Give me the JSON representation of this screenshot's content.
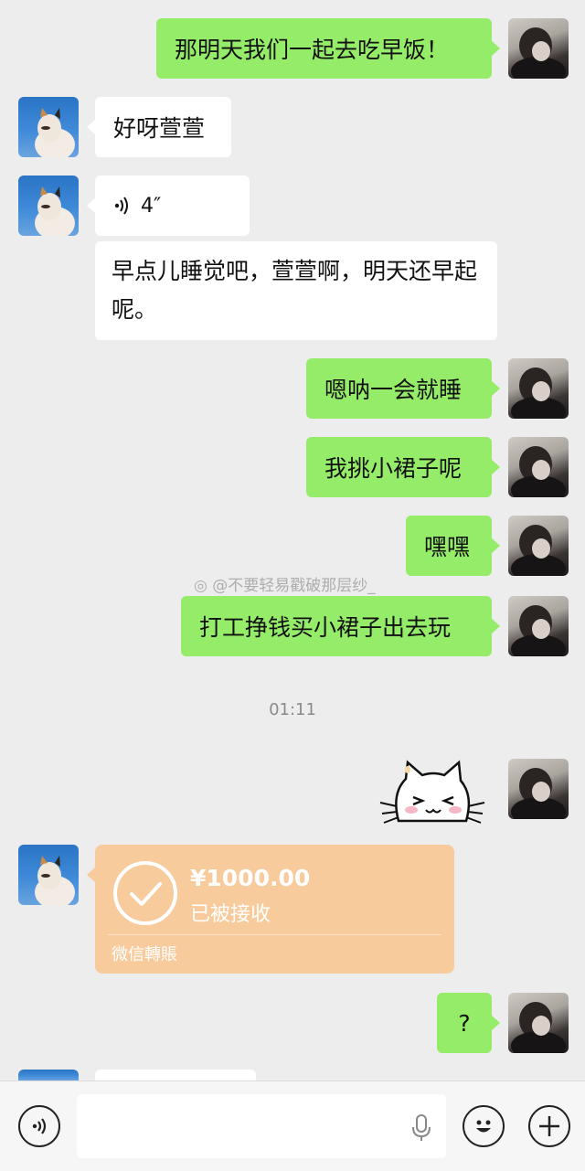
{
  "messages": {
    "m1": "那明天我们一起去吃早饭！",
    "m2": "好呀萱萱",
    "m3_voice_duration": "4″",
    "m4": "早点儿睡觉吧，萱萱啊，明天还早起呢。",
    "m5": "嗯呐一会就睡",
    "m6": "我挑小裙子呢",
    "m7": "嘿嘿",
    "m8": "打工挣钱买小裙子出去玩",
    "m9": "?"
  },
  "watermark": "@不要轻易戳破那层纱_",
  "timestamp": "01:11",
  "transfer": {
    "amount": "¥1000.00",
    "status": "已被接收",
    "footer": "微信轉賬"
  },
  "colors": {
    "background": "#ededed",
    "my_bubble": "#95ec69",
    "their_bubble": "#ffffff",
    "transfer_card": "#f8cb9c"
  },
  "icons": [
    "voice-toggle-icon",
    "microphone-icon",
    "emoji-icon",
    "plus-icon",
    "sticker-cat"
  ]
}
